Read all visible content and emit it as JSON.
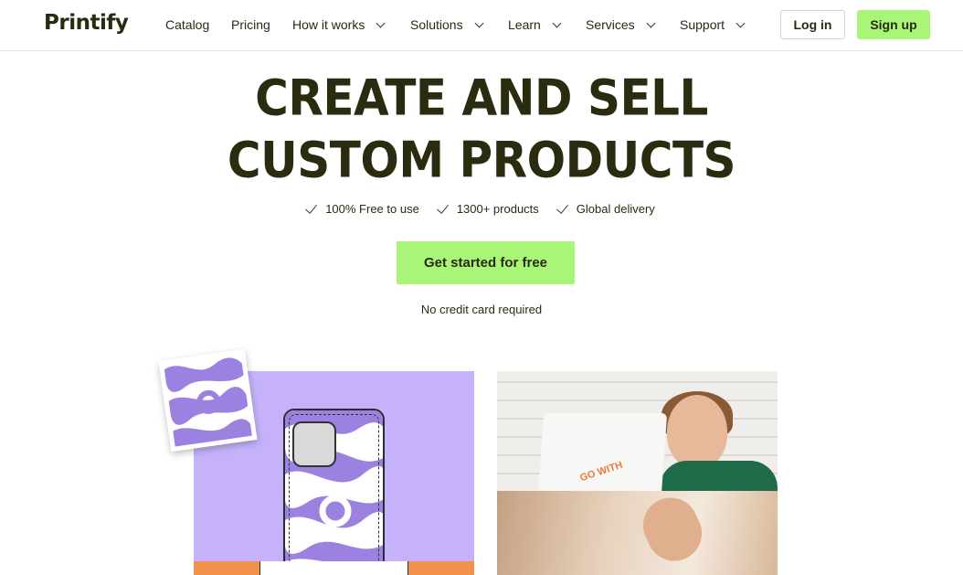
{
  "header": {
    "logo": "Printify",
    "nav": [
      {
        "label": "Catalog",
        "dropdown": false
      },
      {
        "label": "Pricing",
        "dropdown": false
      },
      {
        "label": "How it works",
        "dropdown": true
      },
      {
        "label": "Solutions",
        "dropdown": true
      },
      {
        "label": "Learn",
        "dropdown": true
      },
      {
        "label": "Services",
        "dropdown": true
      },
      {
        "label": "Support",
        "dropdown": true
      }
    ],
    "login_label": "Log in",
    "signup_label": "Sign up"
  },
  "hero": {
    "title_line1": "CREATE AND SELL",
    "title_line2": "CUSTOM PRODUCTS",
    "features": [
      "100% Free to use",
      "1300+ products",
      "Global delivery"
    ],
    "cta_label": "Get started for free",
    "cta_note": "No credit card required"
  },
  "images": {
    "right_shirt_text": "GO WITH"
  },
  "colors": {
    "accent": "#a8f577",
    "text": "#2b2b10",
    "lavender": "#c5b2fb",
    "orange": "#f2914a"
  },
  "icons": {
    "nav_dropdown": "chevron-down-icon",
    "feature": "check-icon"
  }
}
